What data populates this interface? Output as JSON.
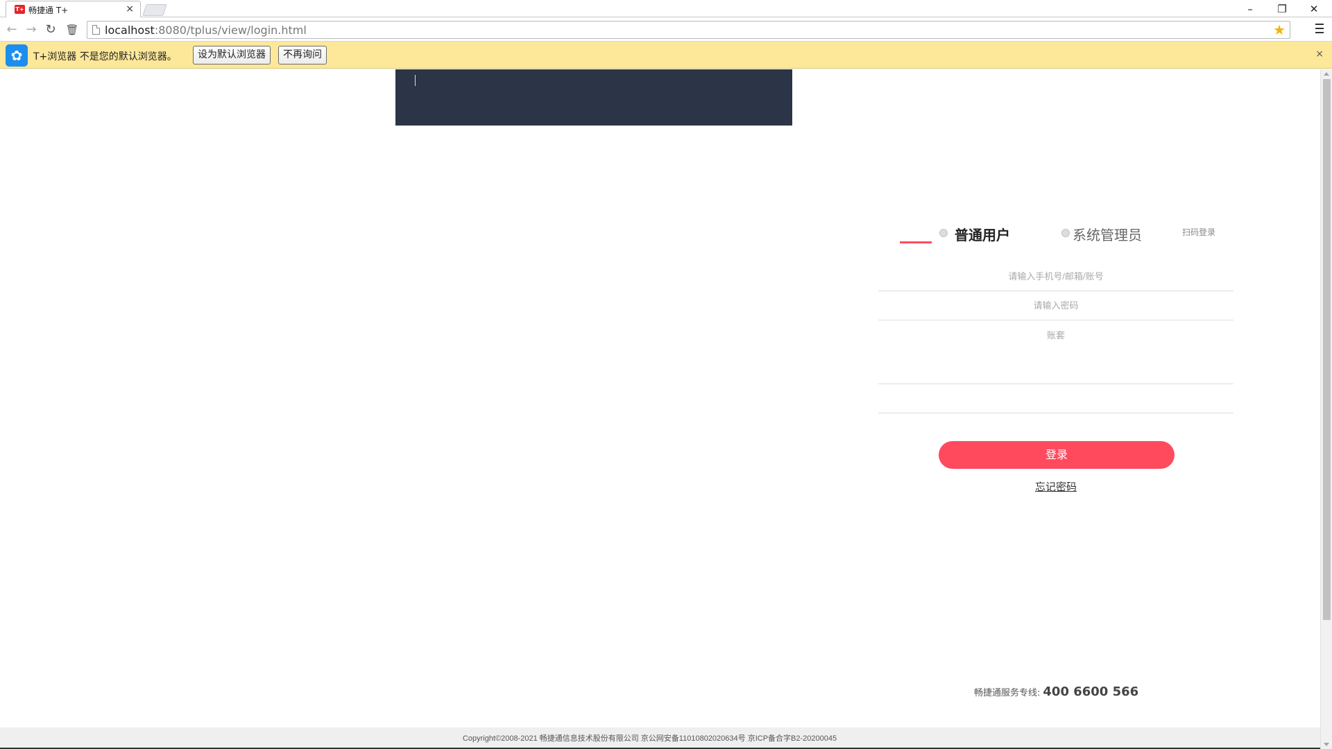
{
  "browser": {
    "tab_title": "畅捷通 T+",
    "tab_favicon_text": "T+",
    "tab_close": "×",
    "window_minimize": "–",
    "window_restore": "❐",
    "window_close": "✕",
    "url_host": "localhost",
    "url_path": ":8080/tplus/view/login.html",
    "back_glyph": "←",
    "forward_glyph": "→",
    "reload_glyph": "↻",
    "trash_glyph": "🗑",
    "star_glyph": "★"
  },
  "infobar": {
    "logo_glyph": "✿",
    "message": "T+浏览器 不是您的默认浏览器。",
    "set_default_label": "设为默认浏览器",
    "dont_ask_label": "不再询问",
    "close_glyph": "×"
  },
  "login": {
    "tab_normal_user": "普通用户",
    "tab_admin": "系统管理员",
    "scan_login": "扫码登录",
    "account_placeholder": "请输入手机号/邮箱/账号",
    "password_placeholder": "请输入密码",
    "accountset_placeholder": "账套",
    "submit_label": "登录",
    "forgot_password": "忘记密码"
  },
  "footer": {
    "hotline_label": "畅捷通服务专线:",
    "hotline_number": "400 6600 566",
    "copyright": "Copyright©2008-2021 畅捷通信息技术股份有限公司 京公网安备11010802020634号 京ICP备合字B2-20200045"
  },
  "colors": {
    "accent": "#ff4a5e",
    "banner": "#2c3447",
    "infobar": "#fde89a"
  }
}
